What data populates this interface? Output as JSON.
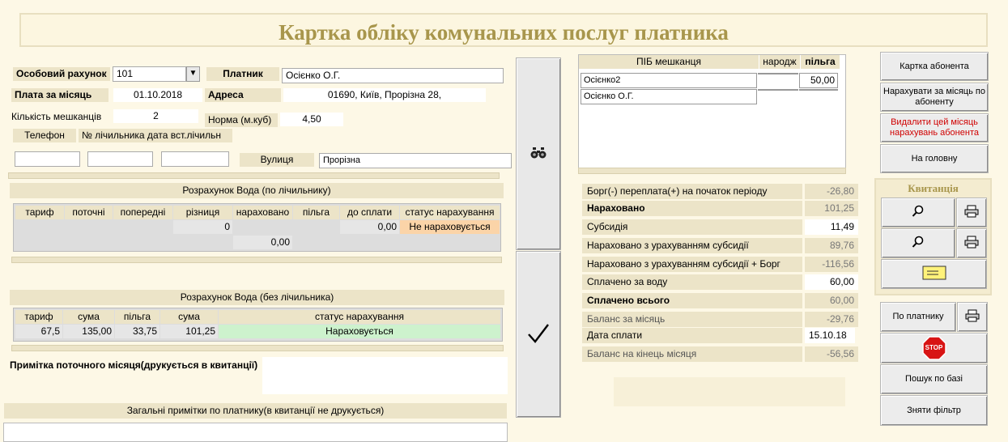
{
  "title": "Картка обліку комунальних послуг платника",
  "account": {
    "label": "Особовий рахунок",
    "value": "101",
    "payer_label": "Платник",
    "payer_value": "Осієнко О.Г.",
    "month_fee_label": "Плата за місяць",
    "month_fee_value": "01.10.2018",
    "address_label": "Адреса",
    "address_value": "01690, Київ, Прорізна 28,",
    "residents_label": "Кількість мешканців",
    "residents_value": "2",
    "norm_label": "Норма (м.куб)",
    "norm_value": "4,50",
    "phone_label": "Телефон",
    "meter_label": "№ лічильника дата вст.лічильн",
    "street_label": "Вулиця",
    "street_value": "Прорізна"
  },
  "water_meter": {
    "title": "Розрахунок Вода (по лічильнику)",
    "headers": [
      "тариф",
      "поточні",
      "попередні",
      "різниця",
      "нараховано",
      "пільга",
      "до сплати",
      "статус нарахування"
    ],
    "row": [
      "",
      "",
      "",
      "0",
      "",
      "",
      "0,00",
      "Не нараховується"
    ],
    "total": "0,00"
  },
  "water_nometer": {
    "title": "Розрахунок Вода (без лічильника)",
    "headers": [
      "тариф",
      "сума",
      "пільга",
      "сума",
      "статус нарахування"
    ],
    "row": [
      "67,5",
      "135,00",
      "33,75",
      "101,25",
      "Нараховується"
    ]
  },
  "notes": {
    "current_label": "Примітка поточного місяця(друкується в квитанції)",
    "general_label": "Загальні примітки по платнику(в квитанції не друкується)"
  },
  "residents": {
    "headers": [
      "ПІБ мешканця",
      "народж",
      "пільга"
    ],
    "rows": [
      {
        "name": "Осієнко2",
        "birth": "",
        "benefit": "50,00"
      },
      {
        "name": "Осієнко О.Г.",
        "birth": "",
        "benefit": ""
      }
    ]
  },
  "summary": [
    {
      "label": "Борг(-) переплата(+) на початок періоду",
      "value": "-26,80"
    },
    {
      "label": "Нараховано",
      "value": "101,25"
    },
    {
      "label": "Субсидія",
      "value": "11,49"
    },
    {
      "label": "Нараховано з урахуванням субсидії",
      "value": "89,76"
    },
    {
      "label": "Нараховано з урахуванням субсидії + Борг",
      "value": "-116,56"
    },
    {
      "label": "Сплачено за воду",
      "value": "60,00"
    },
    {
      "label": "Сплачено всього",
      "value": "60,00"
    },
    {
      "label": "Баланс за місяць",
      "value": "-29,76"
    },
    {
      "label": "Дата сплати",
      "value": "15.10.18"
    },
    {
      "label": "Баланс на кінець місяця",
      "value": "-56,56"
    }
  ],
  "buttons": {
    "card": "Картка абонента",
    "charge": "Нарахувати за місяць по абоненту",
    "delete": "Видалити цей місяць нарахувань абонента",
    "home": "На головну",
    "receipt_title": "Квитанція",
    "by_payer": "По платнику",
    "stop": "STOP",
    "search_db": "Пошук по базі",
    "clear_filter": "Зняти фільтр"
  },
  "colors": {
    "accent": "#a8964c",
    "panel": "#ece4c8",
    "status_not_charged": "#fbd4a8",
    "status_charged": "#cdf2cd",
    "stop_red": "#d81414"
  }
}
